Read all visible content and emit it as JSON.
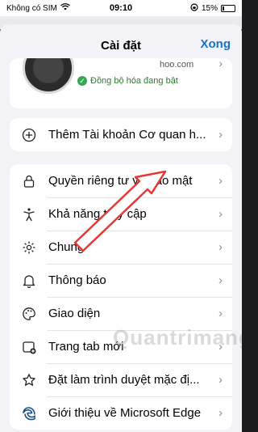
{
  "status_bar": {
    "carrier": "Không có SIM",
    "time": "09:10",
    "battery": "15%",
    "battery_level": 0.15
  },
  "header": {
    "title": "Cài đặt",
    "done_label": "Xong"
  },
  "account": {
    "email_partial": "hoo.com",
    "sync_status": "Đồng bộ hóa đang bật"
  },
  "add_account": {
    "label": "Thêm Tài khoản Cơ quan h..."
  },
  "settings": {
    "items": [
      {
        "label": "Quyền riêng tư và bảo mật",
        "icon": "lock-icon"
      },
      {
        "label": "Khả năng truy cập",
        "icon": "accessibility-icon"
      },
      {
        "label": "Chung",
        "icon": "gear-icon"
      },
      {
        "label": "Thông báo",
        "icon": "bell-icon"
      },
      {
        "label": "Giao diện",
        "icon": "palette-icon"
      },
      {
        "label": "Trang tab mới",
        "icon": "new-tab-icon"
      },
      {
        "label": "Đặt làm trình duyệt mặc đị...",
        "icon": "star-icon"
      },
      {
        "label": "Giới thiệu về Microsoft Edge",
        "icon": "edge-logo-icon"
      }
    ]
  },
  "watermark": "Quantrimang",
  "colors": {
    "accent": "#1a73c8",
    "sync_green": "#34a853",
    "arrow_red": "#e53935"
  }
}
